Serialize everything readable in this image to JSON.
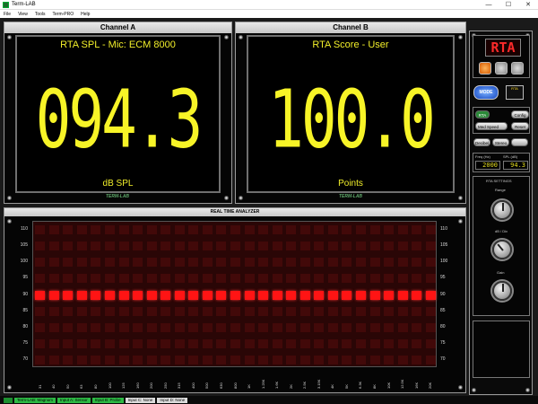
{
  "window": {
    "title": "Term-LAB",
    "controls": [
      "—",
      "☐",
      "✕"
    ]
  },
  "menu": [
    "File",
    "View",
    "Tools",
    "Term-PRO",
    "Help"
  ],
  "channel_a": {
    "header": "Channel A",
    "label_top": "RTA SPL - Mic: ECM 8000",
    "value": "094.3",
    "unit": "dB SPL",
    "brand": "TERM-LAB"
  },
  "channel_b": {
    "header": "Channel B",
    "label_top": "RTA Score - User",
    "value": "100.0",
    "unit": "Points",
    "brand": "TERM-LAB"
  },
  "rta": {
    "title": "REAL TIME ANALYZER",
    "y_labels": [
      "110",
      "105",
      "100",
      "95",
      "90",
      "85",
      "80",
      "75",
      "70"
    ],
    "active_row_label": "90",
    "x_labels": [
      "31",
      "40",
      "50",
      "63",
      "80",
      "100",
      "125",
      "160",
      "200",
      "250",
      "315",
      "400",
      "500",
      "630",
      "800",
      "1K",
      "1.25K",
      "1.6K",
      "2K",
      "2.5K",
      "3.15K",
      "4K",
      "5K",
      "6.3K",
      "8K",
      "10K",
      "12.5K",
      "16K",
      "20K"
    ]
  },
  "side": {
    "rta_badge": "RTA",
    "mode_label": "MODE",
    "mini_rta": "RTA",
    "preset_value": "RTA",
    "config_label": "Config",
    "speed_value": "Med Speed",
    "reset_label": "Reset",
    "tabs": [
      "Decibel",
      "Stereo",
      ""
    ],
    "freq_label": "Freq (Hz)",
    "spl_label": "SPL (dB)",
    "freq_value": "2000",
    "spl_value": "94.3",
    "settings_title": "RTA SETTINGS",
    "range_label": "Range",
    "db_label": "dB / Div",
    "gain_label": "Gain"
  },
  "statusbar": [
    "Term-LAB: Magnum",
    "Input A: Sensor",
    "Input B: Probe",
    "Input C: None",
    "Input D: None"
  ]
}
